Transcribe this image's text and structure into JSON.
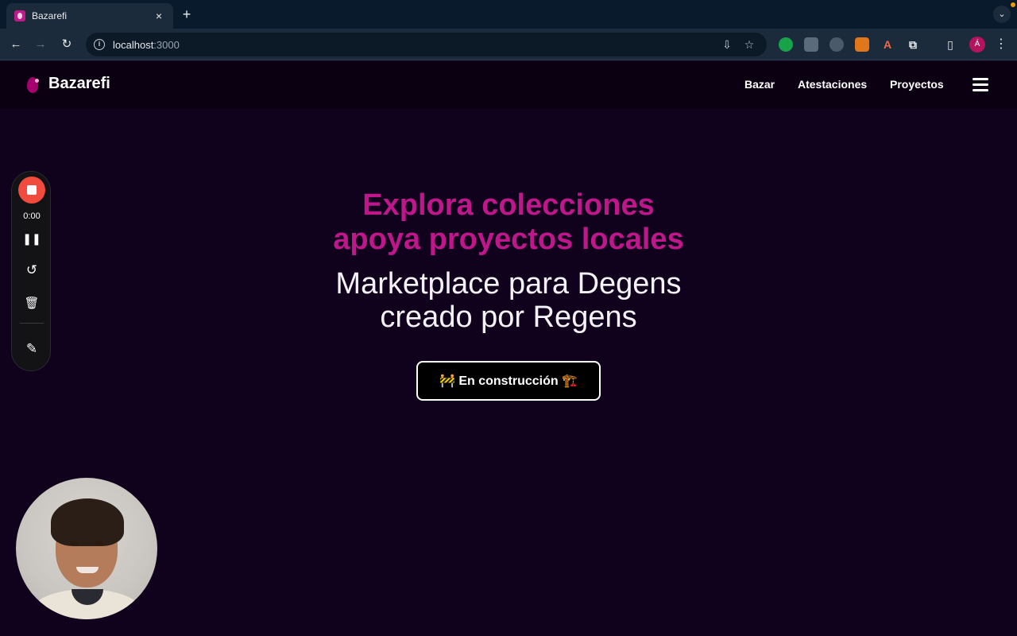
{
  "browser": {
    "tab_title": "Bazarefi",
    "tab_close": "×",
    "new_tab": "+",
    "url_host": "localhost",
    "url_port": ":3000",
    "profile_initial": "Á"
  },
  "site": {
    "brand": "Bazarefi",
    "nav": [
      "Bazar",
      "Atestaciones",
      "Proyectos"
    ]
  },
  "hero": {
    "accent_line1": "Explora colecciones",
    "accent_line2": "apoya proyectos locales",
    "main_line1": "Marketplace para Degens",
    "main_line2": "creado por Regens",
    "cta_label": "🚧 En construcción 🏗️"
  },
  "recorder": {
    "time": "0:00"
  },
  "colors": {
    "page_bg": "#10011c",
    "accent": "#c0168c",
    "record": "#f04b3d"
  }
}
